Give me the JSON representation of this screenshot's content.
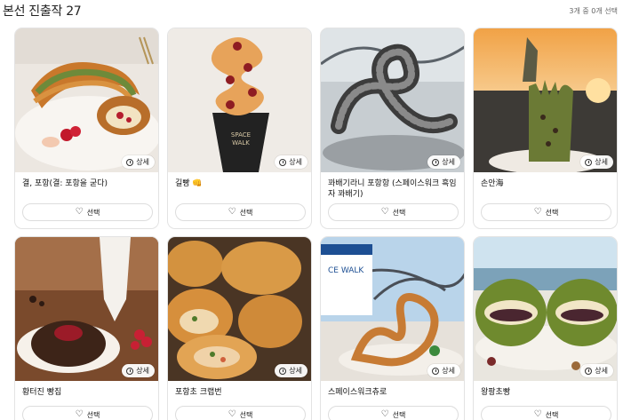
{
  "header": {
    "title": "본선 진출작 27",
    "selection_status": "3개 중 0개 선택"
  },
  "common": {
    "detail_label": "상세",
    "select_label": "선택",
    "heart_glyph": "♡"
  },
  "cards": [
    {
      "name": "결, 포항(결: 포항을 굳다)",
      "image": "croissant-pastry"
    },
    {
      "name": "길빵 👊",
      "image": "twisted-bread-cup"
    },
    {
      "name": "꽈배기라니 포항항 (스페이스워크 흑임자 꽈배기)",
      "image": "black-sesame-twist"
    },
    {
      "name": "손안海",
      "image": "hand-sculpture-bread"
    },
    {
      "name": "황터진 빵집",
      "image": "chocolate-cake"
    },
    {
      "name": "포항초 크랩번",
      "image": "crab-buns"
    },
    {
      "name": "스페이스워크츄로",
      "image": "space-walk-churro"
    },
    {
      "name": "왕팡초빵",
      "image": "green-filled-bread"
    }
  ],
  "colors": {
    "border": "#e3e3e3",
    "text": "#111111"
  }
}
